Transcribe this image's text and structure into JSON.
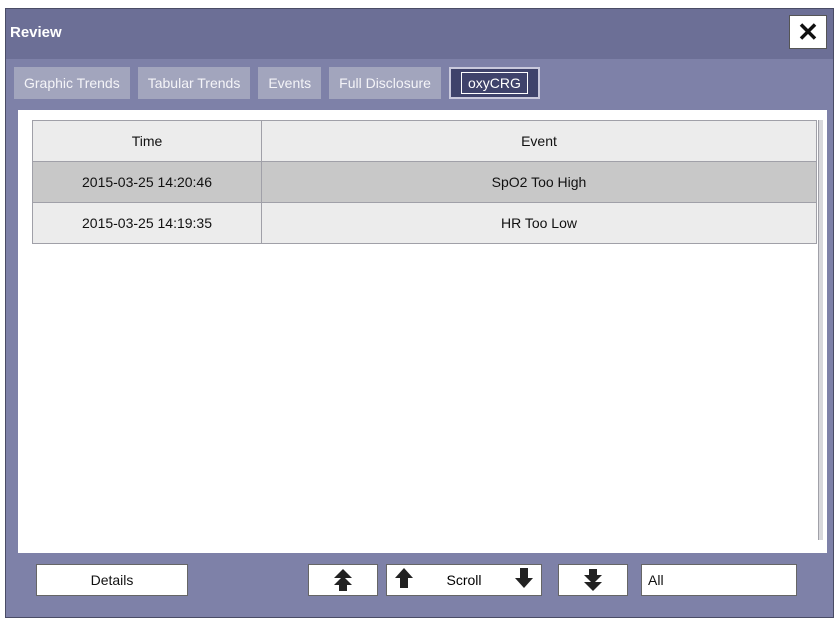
{
  "window": {
    "title": "Review",
    "close_label": "✕"
  },
  "tabs": [
    {
      "label": "Graphic Trends",
      "active": false
    },
    {
      "label": "Tabular Trends",
      "active": false
    },
    {
      "label": "Events",
      "active": false
    },
    {
      "label": "Full Disclosure",
      "active": false
    },
    {
      "label": "oxyCRG",
      "active": true
    }
  ],
  "table": {
    "columns": [
      "Time",
      "Event"
    ],
    "rows": [
      {
        "time": "2015-03-25 14:20:46",
        "event": "SpO2 Too High",
        "selected": true
      },
      {
        "time": "2015-03-25 14:19:35",
        "event": "HR Too Low",
        "selected": false
      }
    ]
  },
  "toolbar": {
    "details_label": "Details",
    "page_up_icon": "double-arrow-up-icon",
    "scroll_up_icon": "arrow-up-icon",
    "scroll_label": "Scroll",
    "scroll_down_icon": "arrow-down-icon",
    "page_down_icon": "double-arrow-down-icon",
    "filter_value": "All"
  },
  "colors": {
    "title_bar": "#6c6f96",
    "window_bg": "#7e81a8",
    "tab_active": "#3f436b",
    "tab_inactive": "#a2a5bd",
    "row_selected": "#c8c8c8"
  }
}
